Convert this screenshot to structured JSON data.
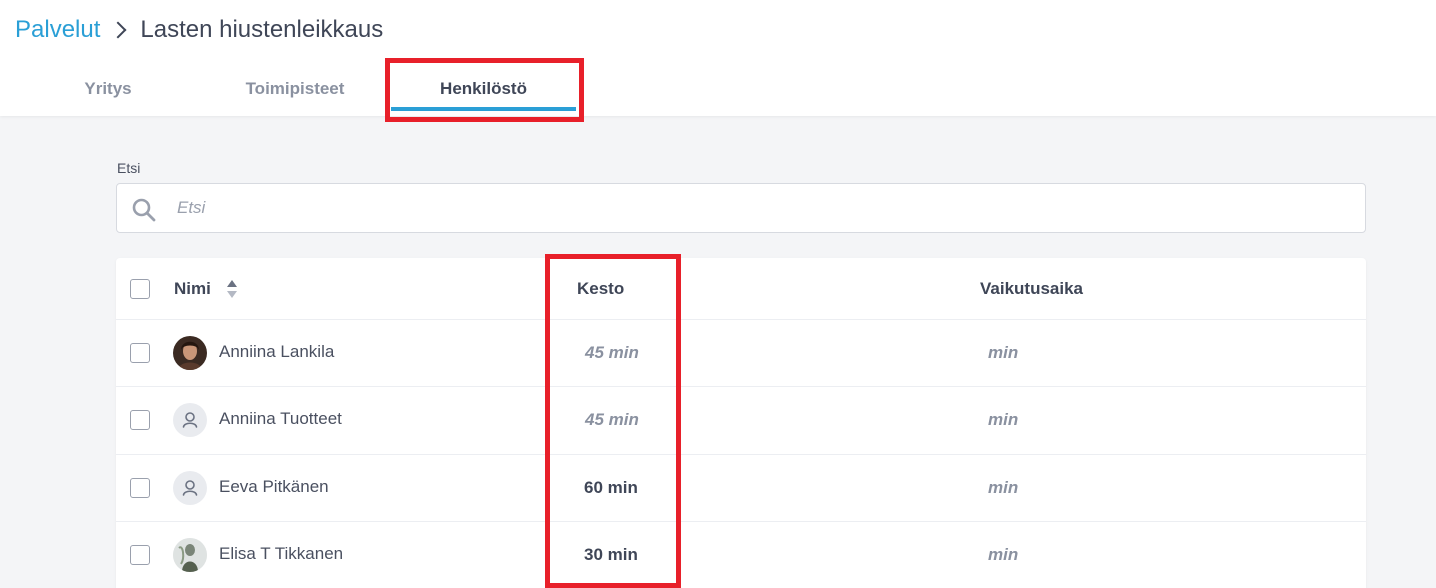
{
  "breadcrumb": {
    "parent": "Palvelut",
    "current": "Lasten hiustenleikkaus"
  },
  "tabs": [
    {
      "label": "Yritys"
    },
    {
      "label": "Toimipisteet"
    },
    {
      "label": "Henkilöstö"
    }
  ],
  "search": {
    "label": "Etsi",
    "placeholder": "Etsi",
    "value": ""
  },
  "table": {
    "headers": {
      "name": "Nimi",
      "duration": "Kesto",
      "effect_time": "Vaikutusaika"
    },
    "rows": [
      {
        "name": "Anniina Lankila",
        "duration": "45 min",
        "effect_time": "min"
      },
      {
        "name": "Anniina Tuotteet",
        "duration": "45 min",
        "effect_time": "min"
      },
      {
        "name": "Eeva Pitkänen",
        "duration": "60 min",
        "effect_time": "min"
      },
      {
        "name": "Elisa T Tikkanen",
        "duration": "30 min",
        "effect_time": "min"
      }
    ]
  },
  "colors": {
    "accent": "#2a9fd6",
    "highlight": "#e8202a",
    "text_dark": "#3f4657",
    "text_muted": "#8a91a0"
  }
}
